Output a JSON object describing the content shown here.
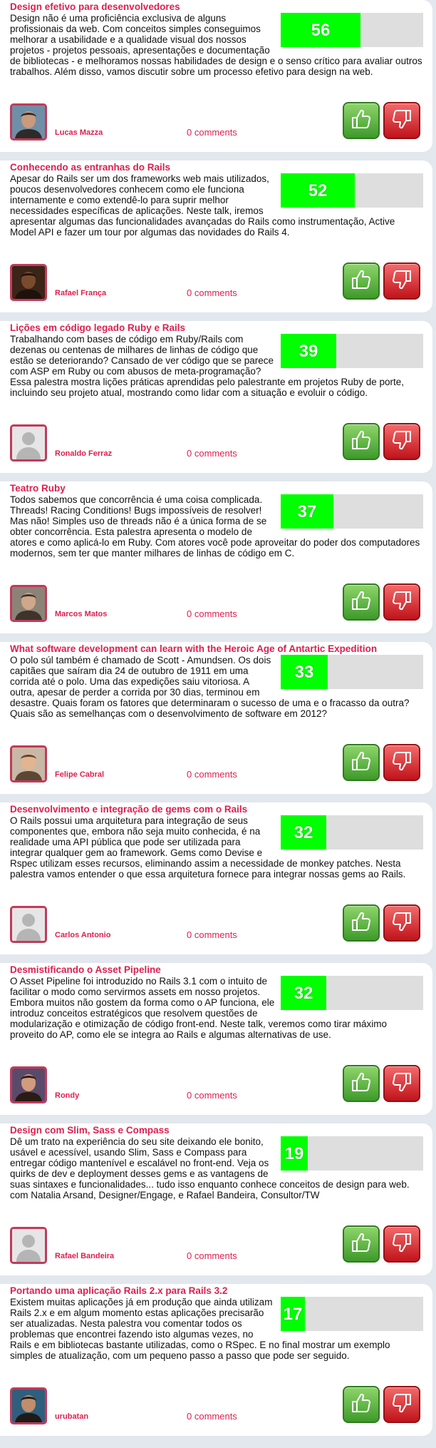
{
  "talks": [
    {
      "title": "Design efetivo para desenvolvedores",
      "description": "Design não é uma proficiência exclusiva de alguns profissionais da web. Com conceitos simples conseguimos melhorar a usabilidade e a qualidade visual dos nossos projetos - projetos pessoais, apresentações e documentação de bibliotecas - e melhoramos nossas habilidades de design e o senso crítico para avaliar outros trabalhos. Além disso, vamos discutir sobre um processo efetivo para design na web.",
      "score": "56",
      "author": "Lucas Mazza",
      "comments": "0 comments",
      "avatar": "photo"
    },
    {
      "title": "Conhecendo as entranhas do Rails",
      "description": "Apesar do Rails ser um dos frameworks web mais utilizados, poucos desenvolvedores conhecem como ele funciona internamente e como extendê-lo para suprir melhor necessidades específicas de aplicações. Neste talk, iremos apresentar algumas das funcionalidades avançadas do Rails como instrumentação, Active Model API e fazer um tour por algumas das novidades do Rails 4.",
      "score": "52",
      "author": "Rafael França",
      "comments": "0 comments",
      "avatar": "photo"
    },
    {
      "title": "Lições em código legado Ruby e Rails",
      "description": "Trabalhando com bases de código em Ruby/Rails com dezenas ou centenas de milhares de linhas de código que estão se deteriorando? Cansado de ver código que se parece com ASP em Ruby ou com abusos de meta-programação? Essa palestra mostra lições práticas aprendidas pelo palestrante em projetos Ruby de porte, incluindo seu projeto atual, mostrando como lidar com a situação e evoluir o código.",
      "score": "39",
      "author": "Ronaldo Ferraz",
      "comments": "0 comments",
      "avatar": "default"
    },
    {
      "title": "Teatro Ruby",
      "description": "Todos sabemos que concorrência é uma coisa complicada. Threads! Racing Conditions! Bugs impossíveis de resolver! Mas não! Simples uso de threads não é a única forma de se obter concorrência. Esta palestra apresenta o modelo de atores e como aplicá-lo em Ruby. Com atores você pode aproveitar do poder dos computadores modernos, sem ter que manter milhares de linhas de código em C.",
      "score": "37",
      "author": "Marcos Matos",
      "comments": "0 comments",
      "avatar": "photo"
    },
    {
      "title": "What software development can learn with the Heroic Age of Antartic Expedition",
      "description": "O polo súl também é chamado de Scott - Amundsen. Os dois capitães que saíram dia 24 de outubro de 1911 em uma corrida até o polo. Uma das expedições saiu vitoriosa. A outra, apesar de perder a corrida por 30 dias, terminou em desastre. Quais foram os fatores que determinaram o sucesso de uma e o fracasso da outra? Quais são as semelhanças com o desenvolvimento de software em 2012?",
      "score": "33",
      "author": "Felipe Cabral",
      "comments": "0 comments",
      "avatar": "photo"
    },
    {
      "title": "Desenvolvimento e integração de gems com o Rails",
      "description": "O Rails possui uma arquitetura para integração de seus componentes que, embora não seja muito conhecida, é na realidade uma API pública que pode ser utilizada para integrar qualquer gem ao framework. Gems como Devise e Rspec utilizam esses recursos, eliminando assim a necessidade de monkey patches. Nesta palestra vamos entender o que essa arquitetura fornece para integrar nossas gems ao Rails.",
      "score": "32",
      "author": "Carlos Antonio",
      "comments": "0 comments",
      "avatar": "default"
    },
    {
      "title": "Desmistificando o Asset Pipeline",
      "description": "O Asset Pipeline foi introduzido no Rails 3.1 com o intuito de facilitar o modo como servirmos assets em nosso projetos. Embora muitos não gostem da forma como o AP funciona, ele introduz conceitos estratégicos que resolvem questões de modularização e otimização de código front-end. Neste talk, veremos como tirar máximo proveito do AP, como ele se integra ao Rails e algumas alternativas de use.",
      "score": "32",
      "author": "Rondy",
      "comments": "0 comments",
      "avatar": "photo"
    },
    {
      "title": "Design com Slim, Sass e Compass",
      "description": "Dê um trato na experiência do seu site deixando ele bonito, usável e acessível, usando Slim, Sass e Compass para entregar código mantenível e escalável no front-end. Veja os quirks de dev e deployment desses gems e as vantagens de suas sintaxes e funcionalidades... tudo isso enquanto conhece conceitos de design para web. com Natalia Arsand, Designer/Engage, e Rafael Bandeira, Consultor/TW",
      "score": "19",
      "author": "Rafael Bandeira",
      "comments": "0 comments",
      "avatar": "default"
    },
    {
      "title": "Portando uma aplicação Rails 2.x para Rails 3.2",
      "description": "Existem muitas aplicações já em produção que ainda utilizam Rails 2.x e em algum momento estas aplicações precisarão ser atualizadas. Nesta palestra vou comentar todos os problemas que encontrei fazendo isto algumas vezes, no Rails e em bibliotecas bastante utilizadas, como o RSpec. E no final mostrar um exemplo simples de atualização, com um pequeno passo a passo que pode ser seguido.",
      "score": "17",
      "author": "urubatan",
      "comments": "0 comments",
      "avatar": "photo"
    }
  ],
  "vote_up_icon": "thumbs-up-icon",
  "vote_down_icon": "thumbs-down-icon",
  "colors": {
    "accent": "#de1f4e",
    "score_fill": "#00ff00",
    "score_track": "#dedede",
    "vote_up": "#4ea83a",
    "vote_down": "#d42027",
    "background": "#e3e7ee"
  }
}
